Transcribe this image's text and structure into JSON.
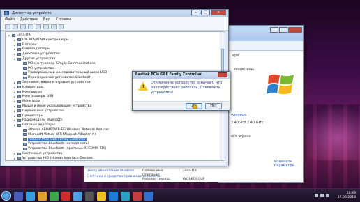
{
  "device_manager": {
    "title": "Диспетчер устройств",
    "menu": [
      "Файл",
      "Действие",
      "Вид",
      "Справка"
    ],
    "tree": [
      {
        "label": "Lena-ПК",
        "level": 0
      },
      {
        "label": "IDE ATA/ATAPI контроллеры",
        "level": 1
      },
      {
        "label": "Батареи",
        "level": 1
      },
      {
        "label": "Видеоадаптеры",
        "level": 1
      },
      {
        "label": "Дисковые устройства",
        "level": 1
      },
      {
        "label": "Другие устройства",
        "level": 1
      },
      {
        "label": "PCI-контроллер Simple Communications",
        "level": 2
      },
      {
        "label": "PCI-устройство",
        "level": 2
      },
      {
        "label": "Универсальный последовательный шина USB",
        "level": 2
      },
      {
        "label": "Периферийное устройство Bluetooth",
        "level": 2
      },
      {
        "label": "Звуковые, видео и игровые устройства",
        "level": 1
      },
      {
        "label": "Клавиатуры",
        "level": 1
      },
      {
        "label": "Компьютер",
        "level": 1
      },
      {
        "label": "Контроллеры USB",
        "level": 1
      },
      {
        "label": "Мониторы",
        "level": 1
      },
      {
        "label": "Мыши и иные указывающие устройства",
        "level": 1
      },
      {
        "label": "Переносные устройства",
        "level": 1
      },
      {
        "label": "Процессоры",
        "level": 1
      },
      {
        "label": "Радиомодули Bluetooth",
        "level": 1
      },
      {
        "label": "Сетевые адаптеры",
        "level": 1
      },
      {
        "label": "Atheros AR9485WB-EG Wireless Network Adapter",
        "level": 2
      },
      {
        "label": "Microsoft Virtual WiFi Miniport Adapter #4",
        "level": 2
      },
      {
        "label": "Realtek PCIe GBE Family Controller",
        "level": 2,
        "selected": true
      },
      {
        "label": "Устройства Bluetooth (личная сеть)",
        "level": 2
      },
      {
        "label": "Устройства Bluetooth (протокол RFCOMM TDI)",
        "level": 2
      },
      {
        "label": "Системные устройства",
        "level": 1
      },
      {
        "label": "Устройства HID (Human Interface Devices)",
        "level": 1
      }
    ]
  },
  "dialog": {
    "title": "Realtek PCIe GBE Family Controller",
    "message": "Отключение устройства означает, что оно перестанет работать. Отключить устройство?",
    "yes": "Да",
    "no": "Нет"
  },
  "system": {
    "snippet1": "ере",
    "snippet2": "защищены.",
    "windows_label": "Windows",
    "cpu": "2.40GHz  2.40 GHz",
    "display": "ого экрана",
    "computer_name_label": "Компьютер:",
    "computer_name": "Lena-ПК",
    "full_name_label": "Полное имя:",
    "full_name": "Lena-ПК",
    "description_label": "Описание:",
    "workgroup_label": "Рабочая группа:",
    "workgroup": "WORKGROUP",
    "change_params": "Изменить параметры",
    "support_center": "Центр поддержки",
    "update_center": "Центр обновления Windows",
    "perf_counters": "Счетчики и средства производительности"
  },
  "taskbar": {
    "time": "10:49",
    "date": "27.06.2013"
  },
  "colors": {
    "accent": "#3a79d3",
    "dialog_text": "#1a3d85",
    "warn": "#f2c93a"
  }
}
